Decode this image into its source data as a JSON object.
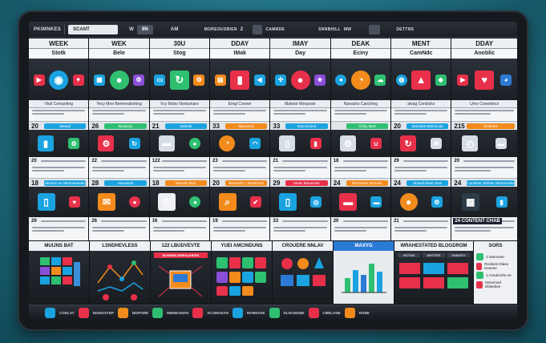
{
  "topbar": {
    "brand": "PKIMNKES",
    "search_value": "SCANT",
    "item_2": "W",
    "item_3": "9N",
    "item_4": "AM",
    "item_5": "MOREOUSBIEN",
    "item_6": "2",
    "item_7": "CAMNDE",
    "item_8": "SNNBHILL",
    "item_9": "MW",
    "item_10": "DETTNS"
  },
  "columns": [
    {
      "head": "WEEK",
      "sub": "Stotk",
      "caption": "Vbol Comanting",
      "num_a": "20",
      "pill_a": "Meeed",
      "num_b": "18",
      "pill_b": "Hlneere ee Weeneeeeles",
      "num_c": "20",
      "num_d": "29"
    },
    {
      "head": "WEK",
      "sub": "Bele",
      "caption": "Yecy Mne Benmnabshing",
      "num_a": "26",
      "pill_a": "Rmaenly",
      "num_b": "28",
      "pill_b": "Heunerds",
      "num_c": "22",
      "num_d": "26"
    },
    {
      "head": "30U",
      "sub": "Stog",
      "caption": "Vcy Mcbo Nestumare",
      "num_a": "21",
      "pill_a": "Stelenk",
      "num_b": "18",
      "pill_b": "Baunde Moe",
      "num_c": "122",
      "num_d": "16"
    },
    {
      "head": "DDAY",
      "sub": "IMak",
      "caption": "Emgl Conner",
      "num_a": "33",
      "pill_a": "Marneses",
      "num_b": "20",
      "pill_b": "Beoaerts + Reeuhese",
      "num_c": "23",
      "num_d": "19"
    },
    {
      "head": "IMAY",
      "sub": "Day",
      "caption": "Mabest Weopsier",
      "num_a": "33",
      "pill_a": "Mocnoened",
      "num_b": "29",
      "pill_b": "Muas Bloeenset",
      "num_c": "21",
      "num_d": "33"
    },
    {
      "head": "DEAK",
      "sub": "Eciny",
      "caption": "Nanachs Canching",
      "num_a": "",
      "pill_a": "Chiky Mart",
      "num_b": "24",
      "pill_b": "Resnnnes Moneee",
      "num_c": "18",
      "num_d": "20"
    },
    {
      "head": "MENT",
      "sub": "CamNdc",
      "caption": "alvag Cenblcks",
      "num_a": "20",
      "pill_a": "Mnenbet Eltehenda",
      "num_b": "24",
      "pill_b": "Moaehnbeen Boe",
      "num_c": "29",
      "num_d": "21"
    },
    {
      "head": "DDAY",
      "sub": "Anoblic",
      "caption": "Umo Conentncs",
      "num_a": "215",
      "pill_a": "Einlertes",
      "num_b": "24",
      "pill_b": "Conlnhec Blohee Wheoeeeke",
      "num_c": "20",
      "num_d": "24"
    }
  ],
  "content_hub_label": "24 CONTENT CHAB",
  "bottom_panels": [
    {
      "title": "MUIJNS BAT"
    },
    {
      "title": "LSNDHEVLESS"
    },
    {
      "title": "122 LBUDVEVTE",
      "sub": "BONDEN WREGLIHERS"
    },
    {
      "title": "YUEI AMCINDUNS"
    },
    {
      "title": "CROUERE NNLAV"
    },
    {
      "title": "MAXYG"
    },
    {
      "title": "WRAHESTATED BLOGDROM",
      "tabs": [
        "NOTMS",
        "MHTVEE",
        "DMNVEY"
      ]
    },
    {
      "title": "SORS",
      "rows": [
        "1 Nwirneee",
        "Reobent Dlaee Eeeeee",
        "1 Anndenrhe ee",
        "Nenerned Ebleebee"
      ]
    }
  ],
  "dock": {
    "labels": [
      "CODLAY",
      "NOWGSTEP",
      "NISPORE",
      "MMNEAMAN",
      "SCOMANAN",
      "HOMNAVE",
      "DLNCMGBE",
      "CMELANE",
      "ROBE"
    ]
  },
  "colors": {
    "accent_blue": "#1aa3e0",
    "accent_red": "#e8304a",
    "accent_orange": "#f28b1c",
    "accent_green": "#2fbf71",
    "accent_purple": "#8a4fd8"
  }
}
